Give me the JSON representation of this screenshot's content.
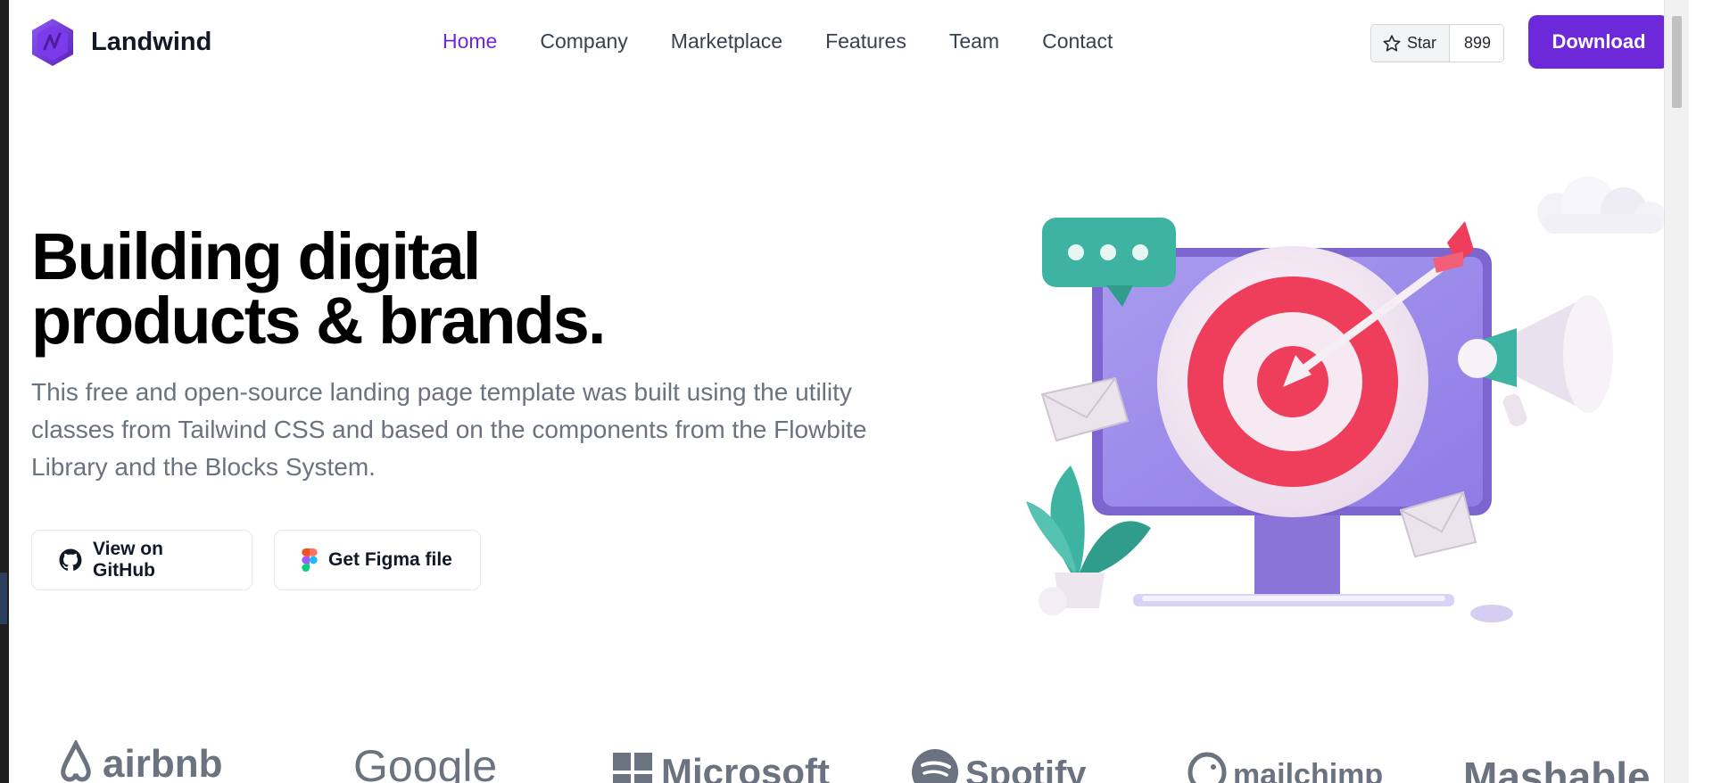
{
  "brand": {
    "name": "Landwind",
    "logo_icon": "landwind-hexagon-logo-icon",
    "accent": "#6d28d9"
  },
  "nav": {
    "items": [
      {
        "label": "Home",
        "active": true
      },
      {
        "label": "Company",
        "active": false
      },
      {
        "label": "Marketplace",
        "active": false
      },
      {
        "label": "Features",
        "active": false
      },
      {
        "label": "Team",
        "active": false
      },
      {
        "label": "Contact",
        "active": false
      }
    ],
    "github_star": {
      "label": "Star",
      "count": "899",
      "icon": "star-icon"
    },
    "download_label": "Download"
  },
  "hero": {
    "title_line1": "Building digital",
    "title_line2": "products & brands.",
    "description": "This free and open-source landing page template was built using the utility classes from Tailwind CSS and based on the components from the Flowbite Library and the Blocks System.",
    "github_button_label": "View on GitHub",
    "figma_button_label": "Get Figma file",
    "illustration": "target-monitor-illustration"
  },
  "logos": {
    "items": [
      "airbnb",
      "Google",
      "Microsoft",
      "Spotify",
      "mailchimp",
      "Mashable"
    ],
    "color": "#6b7280"
  },
  "colors": {
    "primary": "#6d28d9",
    "heading": "#000000",
    "body_text": "#6b7280",
    "nav_text": "#374151"
  }
}
